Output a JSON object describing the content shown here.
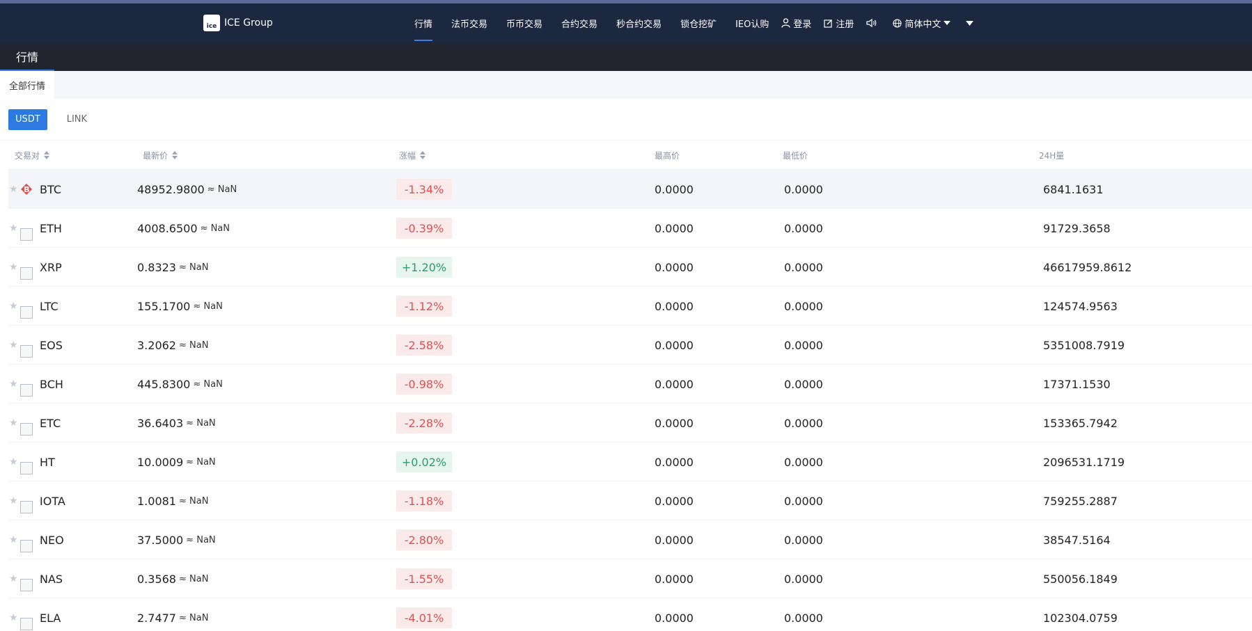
{
  "brand": {
    "name": "ICE Group",
    "logo_text": "ice"
  },
  "nav": [
    {
      "label": "行情",
      "active": true
    },
    {
      "label": "法币交易",
      "active": false
    },
    {
      "label": "币币交易",
      "active": false
    },
    {
      "label": "合约交易",
      "active": false
    },
    {
      "label": "秒合约交易",
      "active": false
    },
    {
      "label": "锁仓挖矿",
      "active": false
    },
    {
      "label": "IEO认购",
      "active": false
    }
  ],
  "auth": {
    "login": "登录",
    "register": "注册"
  },
  "language": "简体中文",
  "subbar": {
    "title": "行情"
  },
  "tabs": {
    "all": "全部行情"
  },
  "coins": [
    {
      "label": "USDT",
      "active": true
    },
    {
      "label": "LINK",
      "active": false
    }
  ],
  "columns": {
    "pair": "交易对",
    "last": "最新价",
    "change": "涨幅",
    "high": "最高价",
    "low": "最低价",
    "volume": "24H量"
  },
  "approx_prefix": "≈",
  "rows": [
    {
      "symbol": "BTC",
      "price": "48952.9800",
      "approx": "NaN",
      "change": "-1.34%",
      "dir": "down",
      "high": "0.0000",
      "low": "0.0000",
      "volume": "6841.1631",
      "highlight": true
    },
    {
      "symbol": "ETH",
      "price": "4008.6500",
      "approx": "NaN",
      "change": "-0.39%",
      "dir": "down",
      "high": "0.0000",
      "low": "0.0000",
      "volume": "91729.3658"
    },
    {
      "symbol": "XRP",
      "price": "0.8323",
      "approx": "NaN",
      "change": "+1.20%",
      "dir": "up",
      "high": "0.0000",
      "low": "0.0000",
      "volume": "46617959.8612"
    },
    {
      "symbol": "LTC",
      "price": "155.1700",
      "approx": "NaN",
      "change": "-1.12%",
      "dir": "down",
      "high": "0.0000",
      "low": "0.0000",
      "volume": "124574.9563"
    },
    {
      "symbol": "EOS",
      "price": "3.2062",
      "approx": "NaN",
      "change": "-2.58%",
      "dir": "down",
      "high": "0.0000",
      "low": "0.0000",
      "volume": "5351008.7919"
    },
    {
      "symbol": "BCH",
      "price": "445.8300",
      "approx": "NaN",
      "change": "-0.98%",
      "dir": "down",
      "high": "0.0000",
      "low": "0.0000",
      "volume": "17371.1530"
    },
    {
      "symbol": "ETC",
      "price": "36.6403",
      "approx": "NaN",
      "change": "-2.28%",
      "dir": "down",
      "high": "0.0000",
      "low": "0.0000",
      "volume": "153365.7942"
    },
    {
      "symbol": "HT",
      "price": "10.0009",
      "approx": "NaN",
      "change": "+0.02%",
      "dir": "up",
      "high": "0.0000",
      "low": "0.0000",
      "volume": "2096531.1719"
    },
    {
      "symbol": "IOTA",
      "price": "1.0081",
      "approx": "NaN",
      "change": "-1.18%",
      "dir": "down",
      "high": "0.0000",
      "low": "0.0000",
      "volume": "759255.2887"
    },
    {
      "symbol": "NEO",
      "price": "37.5000",
      "approx": "NaN",
      "change": "-2.80%",
      "dir": "down",
      "high": "0.0000",
      "low": "0.0000",
      "volume": "38547.5164"
    },
    {
      "symbol": "NAS",
      "price": "0.3568",
      "approx": "NaN",
      "change": "-1.55%",
      "dir": "down",
      "high": "0.0000",
      "low": "0.0000",
      "volume": "550056.1849"
    },
    {
      "symbol": "ELA",
      "price": "2.7477",
      "approx": "NaN",
      "change": "-4.01%",
      "dir": "down",
      "high": "0.0000",
      "low": "0.0000",
      "volume": "102304.0759"
    }
  ],
  "colors": {
    "nav_bg": "#1c2740",
    "accent": "#2d7ae0",
    "down": "#ea4d4d",
    "up": "#1fa36a"
  },
  "icons": [
    "user-icon",
    "edit-icon",
    "speaker-icon",
    "globe-icon",
    "caret-down-icon",
    "star-icon",
    "btc-logo-icon",
    "broken-image-icon"
  ]
}
